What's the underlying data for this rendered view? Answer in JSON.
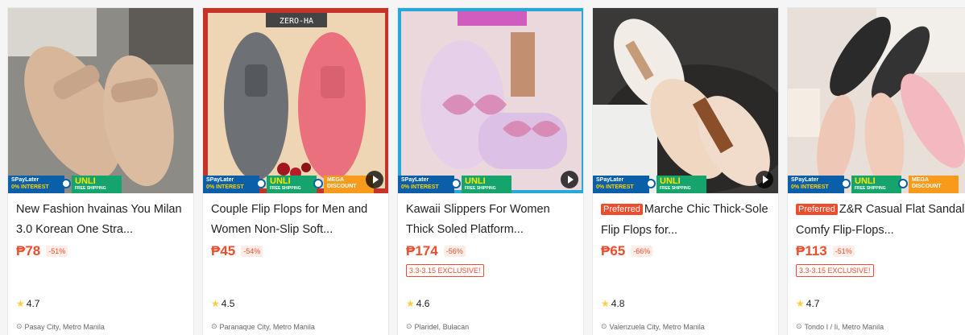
{
  "banners": {
    "spay_top": "SPayLater",
    "spay_bottom": "0% INTEREST",
    "unli_top": "UNLI",
    "unli_bottom": "FREE SHIPPING",
    "mega": "MEGA DISCOUNT"
  },
  "products": [
    {
      "title": "New Fashion hvainas You Milan 3.0 Korean One Stra...",
      "preferred": "",
      "price": "₱78",
      "discount": "-51%",
      "promo": "",
      "rating": "4.7",
      "location": "Pasay City, Metro Manila",
      "has_mega": false,
      "has_play": false
    },
    {
      "title": "Couple Flip Flops for Men and Women Non-Slip Soft...",
      "preferred": "",
      "price": "₱45",
      "discount": "-54%",
      "promo": "",
      "rating": "4.5",
      "location": "Paranaque City, Metro Manila",
      "has_mega": true,
      "has_play": true,
      "image_label": "ZERO-HA"
    },
    {
      "title": "Kawaii Slippers For Women Thick Soled Platform...",
      "preferred": "",
      "price": "₱174",
      "discount": "-56%",
      "promo": "3.3-3.15 EXCLUSIVE!",
      "rating": "4.6",
      "location": "Plaridel, Bulacan",
      "has_mega": false,
      "has_play": true
    },
    {
      "title": "Marche Chic Thick-Sole Flip Flops for...",
      "preferred": "Preferred",
      "price": "₱65",
      "discount": "-66%",
      "promo": "",
      "rating": "4.8",
      "location": "Valenzuela City, Metro Manila",
      "has_mega": false,
      "has_play": true
    },
    {
      "title": "Z&R Casual Flat Sandal Comfy Flip-Flops...",
      "preferred": "Preferred",
      "price": "₱113",
      "discount": "-51%",
      "promo": "3.3-3.15 EXCLUSIVE!",
      "rating": "4.7",
      "location": "Tondo I / Ii, Metro Manila",
      "has_mega": true,
      "has_play": false
    }
  ]
}
